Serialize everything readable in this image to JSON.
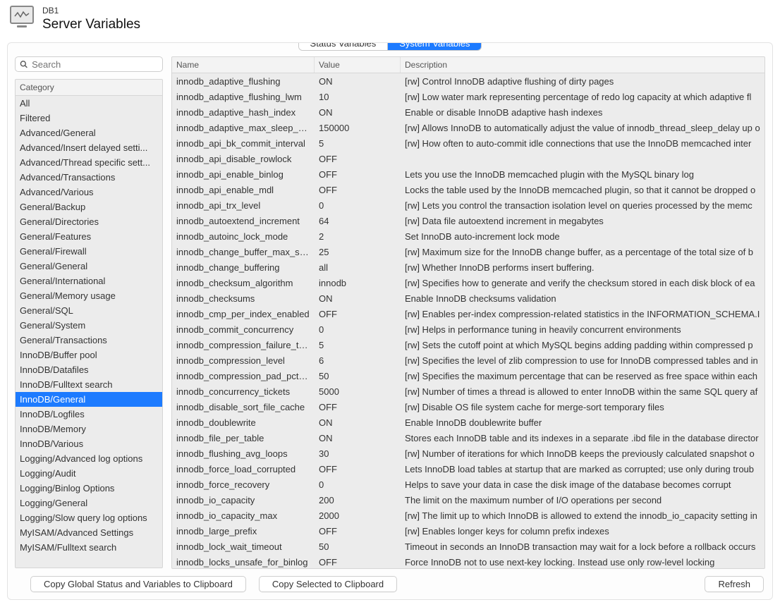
{
  "header": {
    "context": "DB1",
    "title": "Server Variables"
  },
  "tabs": {
    "status": "Status Variables",
    "system": "System Variables",
    "active": "system"
  },
  "search": {
    "placeholder": "Search"
  },
  "category_header": "Category",
  "categories": [
    "All",
    "Filtered",
    "Advanced/General",
    "Advanced/Insert delayed setti...",
    "Advanced/Thread specific sett...",
    "Advanced/Transactions",
    "Advanced/Various",
    "General/Backup",
    "General/Directories",
    "General/Features",
    "General/Firewall",
    "General/General",
    "General/International",
    "General/Memory usage",
    "General/SQL",
    "General/System",
    "General/Transactions",
    "InnoDB/Buffer pool",
    "InnoDB/Datafiles",
    "InnoDB/Fulltext search",
    "InnoDB/General",
    "InnoDB/Logfiles",
    "InnoDB/Memory",
    "InnoDB/Various",
    "Logging/Advanced log options",
    "Logging/Audit",
    "Logging/Binlog Options",
    "Logging/General",
    "Logging/Slow query log options",
    "MyISAM/Advanced Settings",
    "MyISAM/Fulltext search"
  ],
  "selected_category_index": 20,
  "columns": {
    "name": "Name",
    "value": "Value",
    "desc": "Description"
  },
  "rows": [
    {
      "name": "innodb_adaptive_flushing",
      "value": "ON",
      "desc": "[rw] Control InnoDB adaptive flushing of dirty pages"
    },
    {
      "name": "innodb_adaptive_flushing_lwm",
      "value": "10",
      "desc": "[rw] Low water mark representing percentage of redo log capacity at which adaptive fl"
    },
    {
      "name": "innodb_adaptive_hash_index",
      "value": "ON",
      "desc": "Enable or disable InnoDB adaptive hash indexes"
    },
    {
      "name": "innodb_adaptive_max_sleep_d...",
      "value": "150000",
      "desc": "[rw] Allows InnoDB to automatically adjust the value of innodb_thread_sleep_delay up o"
    },
    {
      "name": "innodb_api_bk_commit_interval",
      "value": "5",
      "desc": "[rw] How often to auto-commit idle connections that use the InnoDB memcached inter"
    },
    {
      "name": "innodb_api_disable_rowlock",
      "value": "OFF",
      "desc": ""
    },
    {
      "name": "innodb_api_enable_binlog",
      "value": "OFF",
      "desc": "Lets you use the InnoDB memcached plugin with the MySQL binary log"
    },
    {
      "name": "innodb_api_enable_mdl",
      "value": "OFF",
      "desc": "Locks the table used by the InnoDB memcached plugin, so that it cannot be dropped o"
    },
    {
      "name": "innodb_api_trx_level",
      "value": "0",
      "desc": "[rw] Lets you control the transaction isolation level on queries processed by the memc"
    },
    {
      "name": "innodb_autoextend_increment",
      "value": "64",
      "desc": "[rw] Data file autoextend increment in megabytes"
    },
    {
      "name": "innodb_autoinc_lock_mode",
      "value": "2",
      "desc": "Set InnoDB auto-increment lock mode"
    },
    {
      "name": "innodb_change_buffer_max_size",
      "value": "25",
      "desc": "[rw] Maximum size for the InnoDB change buffer, as a percentage of the total size of b"
    },
    {
      "name": "innodb_change_buffering",
      "value": "all",
      "desc": "[rw] Whether InnoDB performs insert buffering."
    },
    {
      "name": "innodb_checksum_algorithm",
      "value": "innodb",
      "desc": "[rw] Specifies how to generate and verify the checksum stored in each disk block of ea"
    },
    {
      "name": "innodb_checksums",
      "value": "ON",
      "desc": "Enable InnoDB checksums validation"
    },
    {
      "name": "innodb_cmp_per_index_enabled",
      "value": "OFF",
      "desc": "[rw] Enables per-index compression-related statistics in the INFORMATION_SCHEMA.I"
    },
    {
      "name": "innodb_commit_concurrency",
      "value": "0",
      "desc": "[rw] Helps in performance tuning in heavily concurrent environments"
    },
    {
      "name": "innodb_compression_failure_th...",
      "value": "5",
      "desc": "[rw] Sets the cutoff point at which MySQL begins adding padding within compressed p"
    },
    {
      "name": "innodb_compression_level",
      "value": "6",
      "desc": "[rw] Specifies the level of zlib compression to use for InnoDB compressed tables and in"
    },
    {
      "name": "innodb_compression_pad_pct_...",
      "value": "50",
      "desc": "[rw] Specifies the maximum percentage that can be reserved as free space within each"
    },
    {
      "name": "innodb_concurrency_tickets",
      "value": "5000",
      "desc": "[rw] Number of times a thread is allowed to enter InnoDB within the same SQL query af"
    },
    {
      "name": "innodb_disable_sort_file_cache",
      "value": "OFF",
      "desc": "[rw] Disable OS file system cache for merge-sort temporary files"
    },
    {
      "name": "innodb_doublewrite",
      "value": "ON",
      "desc": "Enable InnoDB doublewrite buffer"
    },
    {
      "name": "innodb_file_per_table",
      "value": "ON",
      "desc": "Stores each InnoDB table and its indexes in a separate .ibd file in the database director"
    },
    {
      "name": "innodb_flushing_avg_loops",
      "value": "30",
      "desc": "[rw] Number of iterations for which InnoDB keeps the previously calculated snapshot o"
    },
    {
      "name": "innodb_force_load_corrupted",
      "value": "OFF",
      "desc": "Lets InnoDB load tables at startup that are marked as corrupted; use only during troub"
    },
    {
      "name": "innodb_force_recovery",
      "value": "0",
      "desc": "Helps to save your data in case the disk image of the database becomes corrupt"
    },
    {
      "name": "innodb_io_capacity",
      "value": "200",
      "desc": "The limit on the maximum number of I/O operations per second"
    },
    {
      "name": "innodb_io_capacity_max",
      "value": "2000",
      "desc": "[rw] The limit up to which InnoDB is allowed to extend the innodb_io_capacity setting in"
    },
    {
      "name": "innodb_large_prefix",
      "value": "OFF",
      "desc": "[rw] Enables longer keys for column prefix indexes"
    },
    {
      "name": "innodb_lock_wait_timeout",
      "value": "50",
      "desc": "Timeout in seconds an InnoDB transaction may wait for a lock before a rollback occurs"
    },
    {
      "name": "innodb_locks_unsafe_for_binlog",
      "value": "OFF",
      "desc": "Force InnoDB not to use next-key locking. Instead use only row-level locking"
    }
  ],
  "footer": {
    "copy_global": "Copy Global Status and Variables to Clipboard",
    "copy_selected": "Copy Selected to Clipboard",
    "refresh": "Refresh"
  }
}
